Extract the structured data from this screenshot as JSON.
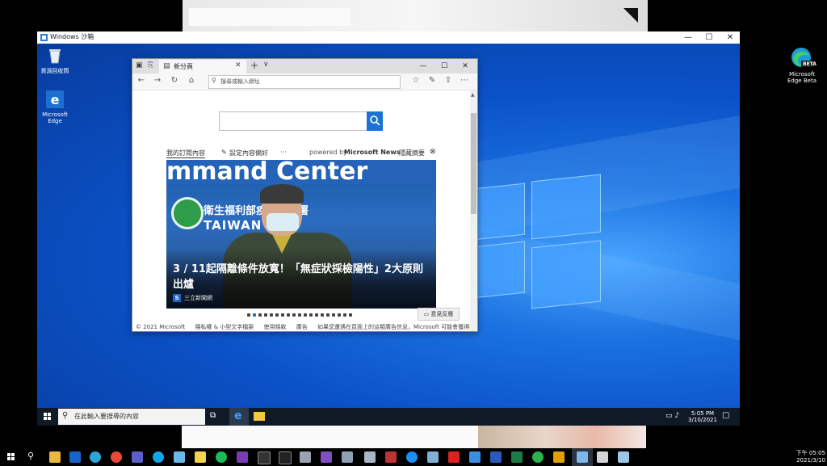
{
  "sandbox": {
    "title": "Windows 沙箱",
    "controls": {
      "minimize": "—",
      "maximize": "☐",
      "close": "✕"
    },
    "desktop_icons": [
      {
        "label": "資源回收筒"
      },
      {
        "label": "Microsoft Edge"
      }
    ],
    "taskbar": {
      "search_placeholder": "在此輸入要搜尋的內容",
      "clock_time": "5:05 PM",
      "clock_date": "3/10/2021"
    }
  },
  "edge": {
    "tab_title": "新分頁",
    "new_tab": "+",
    "tab_dropdown": "∨",
    "address_placeholder": "搜尋或輸入網址",
    "controls": {
      "minimize": "—",
      "maximize": "☐",
      "close": "✕"
    },
    "ntp": {
      "search_button_icon": "search-icon",
      "nav": {
        "my_feed": "我的訂閱內容",
        "personalize": "設定內容偏好",
        "more": "···",
        "powered_by": "powered by",
        "brand": "Microsoft News",
        "hide_feed": "隱藏摘要"
      },
      "hero": {
        "banner_text": "mmand Center",
        "agency_line1": "衛生福利部疾病管制署",
        "agency_line2": "TAIWAN CDC",
        "caption": "3 / 11起隔離條件放寬！「無症狀採檢陽性」2大原則出爐",
        "source_badge": "S",
        "source": "三立新聞網"
      },
      "carousel_dots": 19,
      "carousel_active": 1,
      "feedback_label": "意見反應",
      "footer": [
        "© 2021 Microsoft",
        "隱私權 & 小型文字檔案",
        "使用條款",
        "廣告",
        "如果您遭遇在頁面上的這類廣告信息，Microsoft 可能會獲得報酬"
      ]
    }
  },
  "host_taskbar": {
    "clock_time": "下午 05:05",
    "clock_date": "2021/3/10"
  },
  "host_desktop_icon": {
    "label": "Microsoft Edge Beta",
    "badge": "BETA"
  },
  "colors": {
    "accent": "#1a73d4",
    "desktop_blue": "#0b52c8",
    "taskbar": "#101a26"
  }
}
